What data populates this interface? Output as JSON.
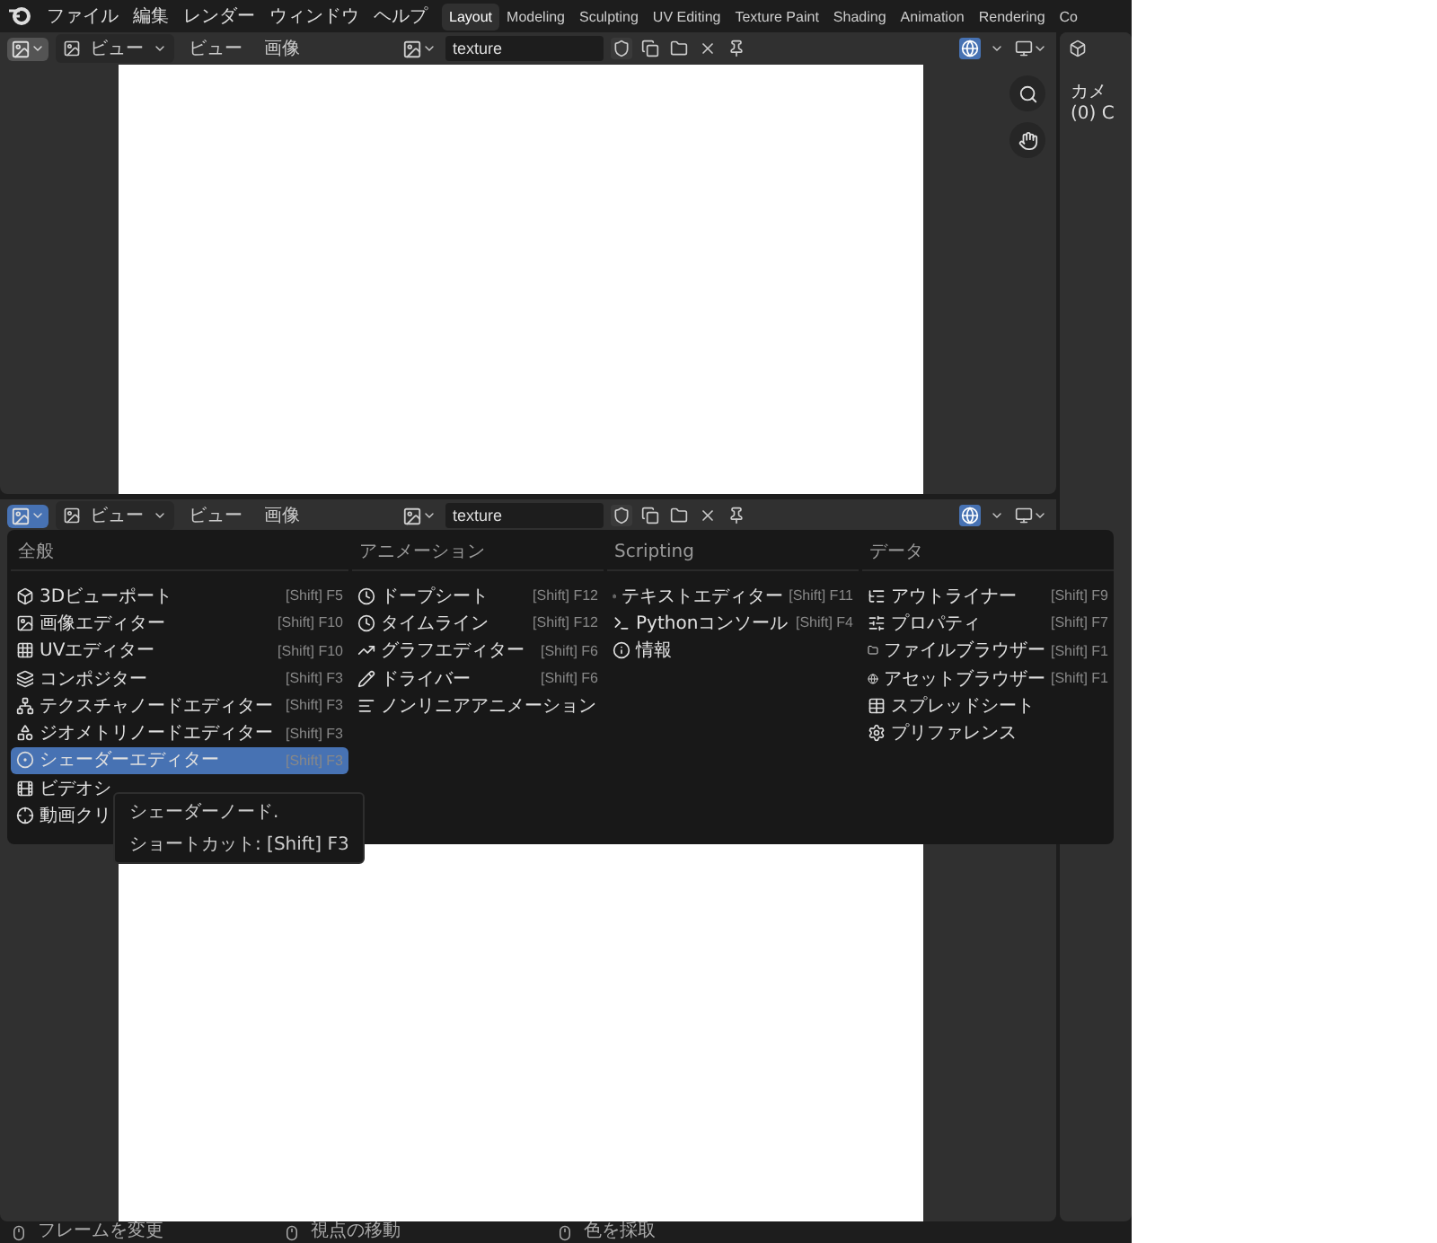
{
  "top_bar": {
    "menus": [
      "ファイル",
      "編集",
      "レンダー",
      "ウィンドウ",
      "ヘルプ"
    ],
    "workspaces": [
      {
        "label": "Layout",
        "selected": true
      },
      {
        "label": "Modeling",
        "selected": false
      },
      {
        "label": "Sculpting",
        "selected": false
      },
      {
        "label": "UV Editing",
        "selected": false
      },
      {
        "label": "Texture Paint",
        "selected": false
      },
      {
        "label": "Shading",
        "selected": false
      },
      {
        "label": "Animation",
        "selected": false
      },
      {
        "label": "Rendering",
        "selected": false
      },
      {
        "label": "Co",
        "selected": false
      }
    ]
  },
  "editors": [
    {
      "editor_type_open": false,
      "view_mode": "ビュー",
      "menus": [
        "ビュー",
        "画像"
      ],
      "image_name": "texture"
    },
    {
      "editor_type_open": true,
      "view_mode": "ビュー",
      "menus": [
        "ビュー",
        "画像"
      ],
      "image_name": "texture"
    }
  ],
  "sidebar": {
    "lines": [
      "カメ",
      "(0) C"
    ]
  },
  "editor_type_menu": {
    "columns": [
      {
        "heading": "全般",
        "items": [
          {
            "label": "3Dビューポート",
            "shortcut": "[Shift] F5",
            "selected": false
          },
          {
            "label": "画像エディター",
            "shortcut": "[Shift] F10",
            "selected": false
          },
          {
            "label": "UVエディター",
            "shortcut": "[Shift] F10",
            "selected": false
          },
          {
            "label": "コンポジター",
            "shortcut": "[Shift] F3",
            "selected": false
          },
          {
            "label": "テクスチャノードエディター",
            "shortcut": "[Shift] F3",
            "selected": false
          },
          {
            "label": "ジオメトリノードエディター",
            "shortcut": "[Shift] F3",
            "selected": false
          },
          {
            "label": "シェーダーエディター",
            "shortcut": "[Shift] F3",
            "selected": true
          },
          {
            "label": "ビデオシ",
            "selected": false
          },
          {
            "label": "動画クリ",
            "selected": false
          }
        ]
      },
      {
        "heading": "アニメーション",
        "items": [
          {
            "label": "ドープシート",
            "shortcut": "[Shift] F12",
            "selected": false
          },
          {
            "label": "タイムライン",
            "shortcut": "[Shift] F12",
            "selected": false
          },
          {
            "label": "グラフエディター",
            "shortcut": "[Shift] F6",
            "selected": false
          },
          {
            "label": "ドライバー",
            "shortcut": "[Shift] F6",
            "selected": false
          },
          {
            "label": "ノンリニアアニメーション",
            "selected": false
          }
        ]
      },
      {
        "heading": "Scripting",
        "items": [
          {
            "label": "テキストエディター",
            "shortcut": "[Shift] F11",
            "selected": false
          },
          {
            "label": "Pythonコンソール",
            "shortcut": "[Shift] F4",
            "selected": false
          },
          {
            "label": "情報",
            "selected": false
          }
        ]
      },
      {
        "heading": "データ",
        "items": [
          {
            "label": "アウトライナー",
            "shortcut": "[Shift] F9",
            "selected": false
          },
          {
            "label": "プロパティ",
            "shortcut": "[Shift] F7",
            "selected": false
          },
          {
            "label": "ファイルブラウザー",
            "shortcut": "[Shift] F1",
            "selected": false
          },
          {
            "label": "アセットブラウザー",
            "shortcut": "[Shift] F1",
            "selected": false
          },
          {
            "label": "スプレッドシート",
            "selected": false
          },
          {
            "label": "プリファレンス",
            "selected": false
          }
        ]
      }
    ]
  },
  "tooltip": {
    "lines": [
      "シェーダーノード.",
      "ショートカット: [Shift] F3"
    ]
  },
  "status_bar": {
    "items": [
      "フレームを変更",
      "視点の移動",
      "色を採取"
    ]
  }
}
